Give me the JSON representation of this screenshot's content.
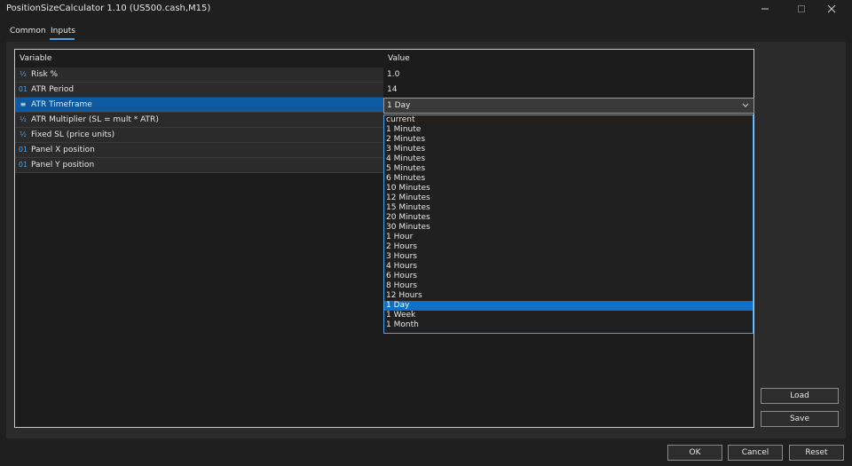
{
  "window": {
    "title": "PositionSizeCalculator 1.10 (US500.cash,M15)"
  },
  "tabs": [
    {
      "label": "Common"
    },
    {
      "label": "Inputs"
    }
  ],
  "grid": {
    "col_variable": "Variable",
    "col_value": "Value",
    "rows": [
      {
        "icon": "½",
        "label": "Risk %",
        "value": "1.0"
      },
      {
        "icon": "01",
        "label": "ATR Period",
        "value": "14"
      },
      {
        "icon": "≡",
        "label": "ATR Timeframe",
        "value": "1 Day"
      },
      {
        "icon": "½",
        "label": "ATR Multiplier (SL = mult * ATR)",
        "value": ""
      },
      {
        "icon": "½",
        "label": "Fixed SL (price units)",
        "value": ""
      },
      {
        "icon": "01",
        "label": "Panel X position",
        "value": ""
      },
      {
        "icon": "01",
        "label": "Panel Y position",
        "value": ""
      }
    ]
  },
  "combo": {
    "selected": "1 Day",
    "options": [
      "current",
      "1 Minute",
      "2 Minutes",
      "3 Minutes",
      "4 Minutes",
      "5 Minutes",
      "6 Minutes",
      "10 Minutes",
      "12 Minutes",
      "15 Minutes",
      "20 Minutes",
      "30 Minutes",
      "1 Hour",
      "2 Hours",
      "3 Hours",
      "4 Hours",
      "6 Hours",
      "8 Hours",
      "12 Hours",
      "1 Day",
      "1 Week",
      "1 Month"
    ]
  },
  "side_buttons": {
    "load": "Load",
    "save": "Save"
  },
  "footer": {
    "ok": "OK",
    "cancel": "Cancel",
    "reset": "Reset"
  },
  "colors": {
    "accent": "#4aa0e6",
    "selection": "#0e70c8"
  }
}
